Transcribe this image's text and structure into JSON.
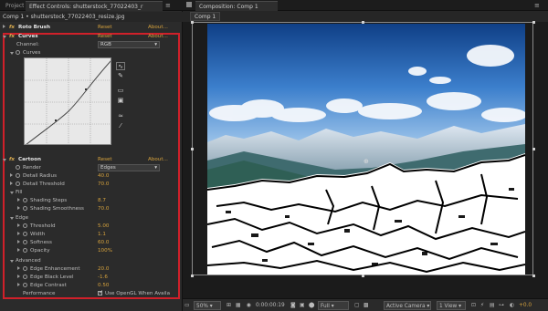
{
  "left_tabs": [
    "Project",
    "Effect Controls: shutterstock_77022403_r"
  ],
  "path": "Comp 1 • shutterstock_77022403_resize.jpg",
  "effects": [
    {
      "name": "Roto Brush",
      "reset": "Reset",
      "about": "About..."
    },
    {
      "name": "Curves",
      "reset": "Reset",
      "about": "About..."
    },
    {
      "name": "Cartoon",
      "reset": "Reset",
      "about": "About..."
    }
  ],
  "curves": {
    "channel_label": "Channel:",
    "channel_value": "RGB",
    "curves_label": "Curves"
  },
  "cartoon": {
    "render_label": "Render",
    "render_value": "Edges",
    "detail_radius_label": "Detail Radius",
    "detail_radius_value": "40.0",
    "detail_threshold_label": "Detail Threshold",
    "detail_threshold_value": "70.0",
    "fill_label": "Fill",
    "shading_steps_label": "Shading Steps",
    "shading_steps_value": "8.7",
    "shading_smoothness_label": "Shading Smoothness",
    "shading_smoothness_value": "70.0",
    "edge_label": "Edge",
    "threshold_label": "Threshold",
    "threshold_value": "5.00",
    "width_label": "Width",
    "width_value": "1.1",
    "softness_label": "Softness",
    "softness_value": "60.0",
    "opacity_label": "Opacity",
    "opacity_value": "100%",
    "advanced_label": "Advanced",
    "edge_enhancement_label": "Edge Enhancement",
    "edge_enhancement_value": "20.0",
    "edge_black_level_label": "Edge Black Level",
    "edge_black_level_value": "-1.6",
    "edge_contrast_label": "Edge Contrast",
    "edge_contrast_value": "0.50",
    "performance_label": "Performance",
    "opengl_label": "Use OpenGL When Availa"
  },
  "right_tab": "Composition: Comp 1",
  "comp_tab": "Comp 1",
  "footer": {
    "zoom": "50%",
    "timecode": "0:00:00:19",
    "resolution": "Full",
    "camera": "Active Camera",
    "views": "1 View",
    "exposure": "+0.0"
  },
  "colors": {
    "accent": "#d6a23d",
    "highlight_border": "#d0202a"
  }
}
